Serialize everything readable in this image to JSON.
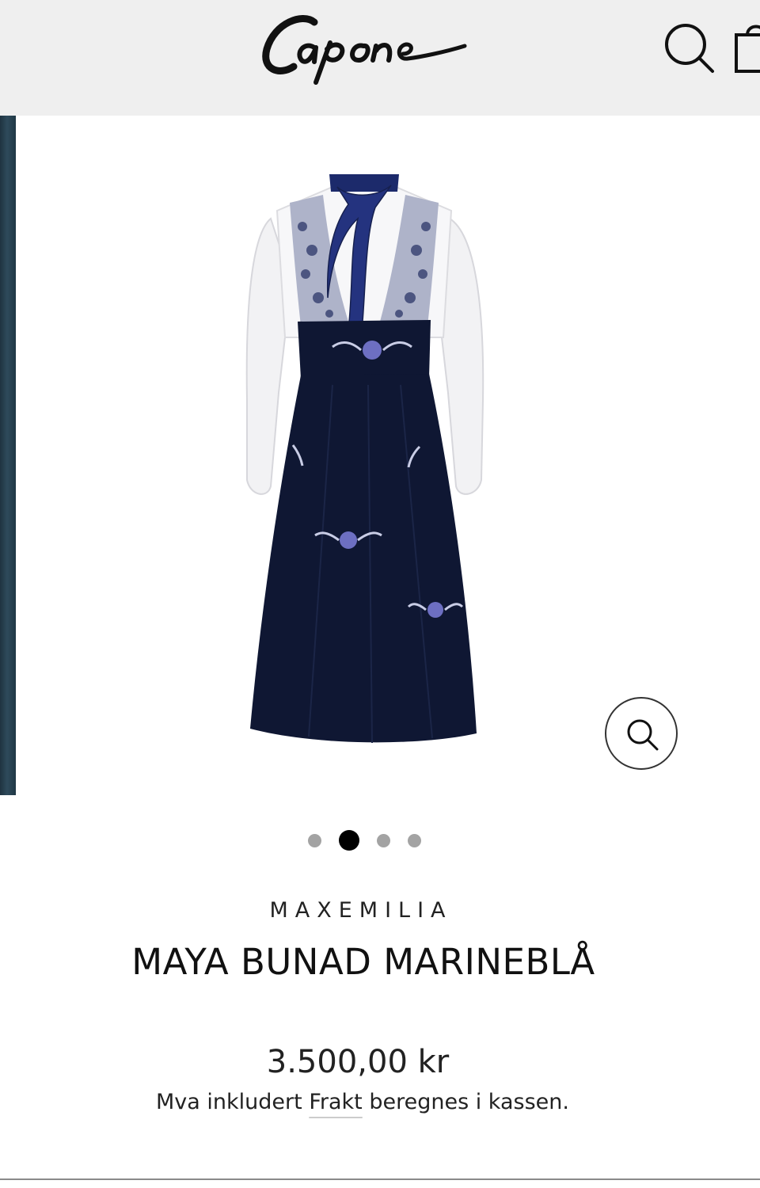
{
  "header": {
    "logo_text": "Capone",
    "search_icon": "search-icon",
    "cart_icon": "cart-icon"
  },
  "gallery": {
    "slide_count": 4,
    "active_slide": 2,
    "zoom_icon": "zoom-icon"
  },
  "product": {
    "vendor": "MAXEMILIA",
    "title": "MAYA BUNAD MARINEBLÅ",
    "price": "3.500,00 kr",
    "tax_note_prefix": "Mva inkludert",
    "shipping_link": "Frakt",
    "tax_note_suffix": "beregnes i kassen."
  },
  "colors": {
    "header_bg": "#efefef",
    "dress_navy": "#0f1733",
    "embroidery_blue": "#6d6fc2",
    "active_dot": "#000000",
    "inactive_dot": "#a3a3a3"
  }
}
